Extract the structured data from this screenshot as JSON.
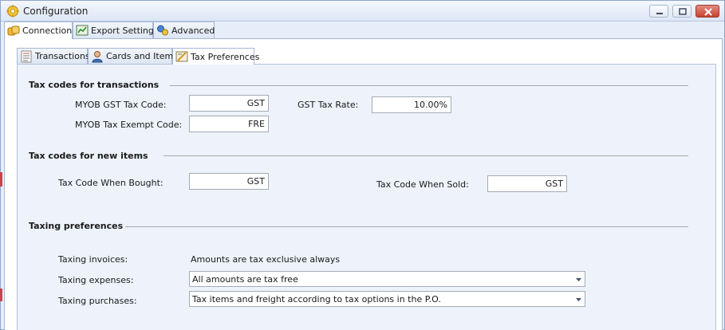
{
  "window": {
    "title": "Configuration"
  },
  "main_tabs": [
    {
      "label": "Connection",
      "icon": "connection-icon"
    },
    {
      "label": "Export Settings",
      "icon": "export-settings-icon"
    },
    {
      "label": "Advanced",
      "icon": "advanced-icon"
    }
  ],
  "sub_tabs": [
    {
      "label": "Transactions",
      "icon": "transactions-icon"
    },
    {
      "label": "Cards and Items",
      "icon": "cards-and-items-icon"
    },
    {
      "label": "Tax Preferences",
      "icon": "tax-preferences-icon"
    }
  ],
  "sections": {
    "transactions": {
      "heading": "Tax codes for transactions",
      "gst_tax_code_label": "MYOB GST Tax Code:",
      "gst_tax_code_value": "GST",
      "gst_tax_rate_label": "GST Tax Rate:",
      "gst_tax_rate_value": "10.00%",
      "tax_exempt_code_label": "MYOB Tax Exempt Code:",
      "tax_exempt_code_value": "FRE"
    },
    "new_items": {
      "heading": "Tax codes for new items",
      "when_bought_label": "Tax Code When Bought:",
      "when_bought_value": "GST",
      "when_sold_label": "Tax Code When Sold:",
      "when_sold_value": "GST"
    },
    "taxing_preferences": {
      "heading": "Taxing preferences",
      "invoices_label": "Taxing invoices:",
      "invoices_value": "Amounts are tax exclusive always",
      "expenses_label": "Taxing expenses:",
      "expenses_value": "All amounts are tax free",
      "purchases_label": "Taxing purchases:",
      "purchases_value": "Tax items and freight according to tax options in the P.O."
    }
  },
  "colors": {
    "accent": "#dce6f5",
    "panel_background": "#edf2fb",
    "close_button": "#c8412f"
  }
}
